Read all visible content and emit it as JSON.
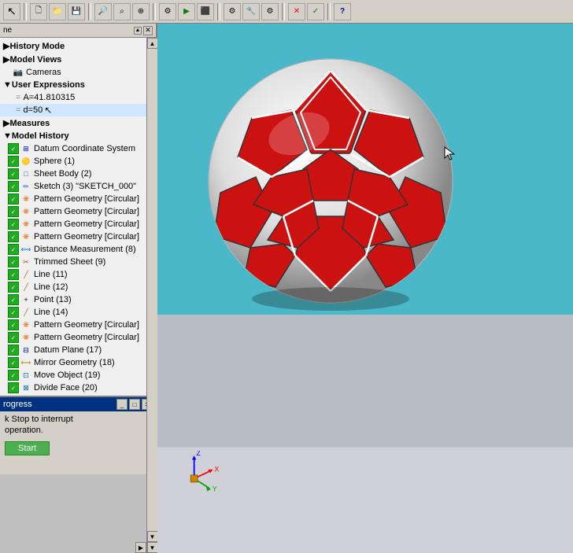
{
  "toolbar": {
    "buttons": [
      {
        "icon": "⬜",
        "name": "new"
      },
      {
        "icon": "📂",
        "name": "open"
      },
      {
        "icon": "💾",
        "name": "save"
      },
      {
        "icon": "✂️",
        "name": "cut"
      },
      {
        "icon": "🔍",
        "name": "zoom-in"
      },
      {
        "icon": "🔍",
        "name": "zoom-out"
      },
      {
        "icon": "🔍",
        "name": "zoom-fit"
      },
      {
        "icon": "⚙",
        "name": "settings"
      },
      {
        "icon": "▶",
        "name": "run"
      },
      {
        "icon": "⏹",
        "name": "stop"
      },
      {
        "icon": "?",
        "name": "help"
      }
    ]
  },
  "panel": {
    "title": "ne",
    "sections": {
      "history_mode": "History Mode",
      "model_views": "Model Views",
      "cameras": "Cameras",
      "user_expressions": "User Expressions",
      "expr1": "A=41.810315",
      "expr2": "d=50",
      "measures": "Measures",
      "model_history": "Model History"
    },
    "tree_items": [
      {
        "label": "Datum Coordinate System",
        "check": true,
        "icon": "datum"
      },
      {
        "label": "Sphere (1)",
        "check": true,
        "icon": "sphere"
      },
      {
        "label": "Sheet Body (2)",
        "check": true,
        "icon": "sheet"
      },
      {
        "label": "Sketch (3) \"SKETCH_000\"",
        "check": true,
        "icon": "sketch"
      },
      {
        "label": "Pattern Geometry [Circular]",
        "check": true,
        "icon": "pattern"
      },
      {
        "label": "Pattern Geometry [Circular]",
        "check": true,
        "icon": "pattern"
      },
      {
        "label": "Pattern Geometry [Circular]",
        "check": true,
        "icon": "pattern"
      },
      {
        "label": "Pattern Geometry [Circular]",
        "check": true,
        "icon": "pattern"
      },
      {
        "label": "Distance Measurement (8)",
        "check": true,
        "icon": "measure"
      },
      {
        "label": "Trimmed Sheet (9)",
        "check": true,
        "icon": "trim"
      },
      {
        "label": "Line (11)",
        "check": true,
        "icon": "line"
      },
      {
        "label": "Line (12)",
        "check": true,
        "icon": "line"
      },
      {
        "label": "Point (13)",
        "check": true,
        "icon": "point"
      },
      {
        "label": "Line (14)",
        "check": true,
        "icon": "line"
      },
      {
        "label": "Pattern Geometry [Circular]",
        "check": true,
        "icon": "pattern"
      },
      {
        "label": "Pattern Geometry [Circular]",
        "check": true,
        "icon": "pattern"
      },
      {
        "label": "Datum Plane (17)",
        "check": true,
        "icon": "datum"
      },
      {
        "label": "Mirror Geometry (18)",
        "check": true,
        "icon": "mirror"
      },
      {
        "label": "Move Object (19)",
        "check": true,
        "icon": "move"
      },
      {
        "label": "Divide Face (20)",
        "check": true,
        "icon": "divide"
      }
    ]
  },
  "progress": {
    "title": "rogress",
    "line1": "k Stop to interrupt",
    "line2": "operation.",
    "start_btn": "Start"
  }
}
